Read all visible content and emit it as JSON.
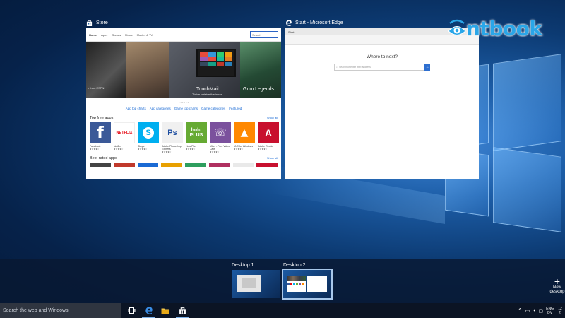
{
  "brand": {
    "name": "ntbook",
    "color": "#2aa6e8"
  },
  "store_window": {
    "title": "Store",
    "icon": "store-bag-icon",
    "nav_tabs": [
      "Home",
      "Apps",
      "Games",
      "Music",
      "Movies & TV"
    ],
    "search_placeholder": "Search",
    "hero": [
      {
        "caption": "",
        "sub": "n from ESPN",
        "color": "#2a2a2a"
      },
      {
        "caption": "",
        "sub": "",
        "color": "#7d6a5a"
      },
      {
        "caption": "TouchMail",
        "sub": "Thrive outside the inbox",
        "color": "#3a3f4a"
      },
      {
        "caption": "Grim Legends",
        "sub": "",
        "color": "#2f5a3a"
      }
    ],
    "links": [
      "App top charts",
      "App categories",
      "Game top charts",
      "Game categories",
      "Featured"
    ],
    "top_free_title": "Top free apps",
    "see_all": "Show all",
    "top_free_apps": [
      {
        "name": "Facebook",
        "glyph": "f",
        "color": "#3b5998"
      },
      {
        "name": "Netflix",
        "glyph": "NETFLIX",
        "color": "#ffffff",
        "text_color": "#e50914"
      },
      {
        "name": "Skype",
        "glyph": "S",
        "color": "#00aff0"
      },
      {
        "name": "Adobe Photoshop Express",
        "glyph": "Ps",
        "color": "#f0f0f0",
        "text_color": "#1f4fa1"
      },
      {
        "name": "Hulu Plus",
        "glyph": "hulu PLUS",
        "color": "#66aa33"
      },
      {
        "name": "Viber - Free Video Calls",
        "glyph": "☏",
        "color": "#7b519d"
      },
      {
        "name": "VLC for Windows",
        "glyph": "▲",
        "color": "#ff8800"
      },
      {
        "name": "Adobe Reader",
        "glyph": "A",
        "color": "#c8102e"
      }
    ],
    "best_rated_title": "Best-rated apps",
    "best_rated_colors": [
      "#444444",
      "#c0392b",
      "#1a6ad4",
      "#e8a000",
      "#2e9e5e",
      "#b03060",
      "#e9e9e9",
      "#c8102e"
    ]
  },
  "edge_window": {
    "title": "Start - Microsoft Edge",
    "icon": "edge-logo-icon",
    "tab_label": "Start",
    "heading": "Where to next?",
    "search_placeholder": "Search or enter web address",
    "go_glyph": "→"
  },
  "virtual_desktops": [
    {
      "label": "Desktop 1",
      "selected": false
    },
    {
      "label": "Desktop 2",
      "selected": true
    }
  ],
  "new_desktop": {
    "plus": "+",
    "label": "New desktop"
  },
  "taskbar": {
    "search_placeholder": "Search the web and Windows",
    "pinned": [
      "task-view-icon",
      "edge-logo-icon",
      "file-explorer-icon",
      "store-bag-icon"
    ],
    "tray": {
      "lang_top": "ENG",
      "lang_bottom": "DV",
      "time": "12",
      "date": "7/"
    }
  }
}
